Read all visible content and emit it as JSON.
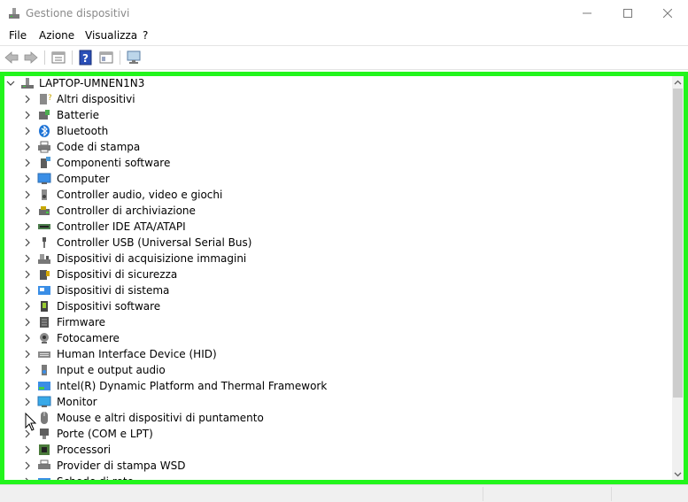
{
  "window": {
    "title": "Gestione dispositivi",
    "app_icon": "device-manager-icon",
    "controls": [
      "minimize-icon",
      "maximize-icon",
      "close-icon"
    ]
  },
  "menu": [
    "File",
    "Azione",
    "Visualizza",
    "?"
  ],
  "toolbar": {
    "buttons": [
      "back-arrow-icon",
      "forward-arrow-icon",
      "properties-icon",
      "help-icon",
      "show-hide-console-icon",
      "scan-hardware-changes-icon"
    ]
  },
  "tree": {
    "root": {
      "label": "LAPTOP-UMNEN1N3",
      "icon": "computer-root-icon",
      "expanded": true
    },
    "items": [
      {
        "label": "Altri dispositivi",
        "icon": "unknown-device-icon"
      },
      {
        "label": "Batterie",
        "icon": "battery-icon"
      },
      {
        "label": "Bluetooth",
        "icon": "bluetooth-icon"
      },
      {
        "label": "Code di stampa",
        "icon": "printer-icon"
      },
      {
        "label": "Componenti software",
        "icon": "software-component-icon"
      },
      {
        "label": "Computer",
        "icon": "computer-icon"
      },
      {
        "label": "Controller audio, video e giochi",
        "icon": "speaker-icon"
      },
      {
        "label": "Controller di archiviazione",
        "icon": "storage-controller-icon"
      },
      {
        "label": "Controller IDE ATA/ATAPI",
        "icon": "ide-controller-icon"
      },
      {
        "label": "Controller USB (Universal Serial Bus)",
        "icon": "usb-icon"
      },
      {
        "label": "Dispositivi di acquisizione immagini",
        "icon": "camera-scanner-icon"
      },
      {
        "label": "Dispositivi di sicurezza",
        "icon": "security-device-icon"
      },
      {
        "label": "Dispositivi di sistema",
        "icon": "system-device-icon"
      },
      {
        "label": "Dispositivi software",
        "icon": "software-device-icon"
      },
      {
        "label": "Firmware",
        "icon": "firmware-icon"
      },
      {
        "label": "Fotocamere",
        "icon": "webcam-icon"
      },
      {
        "label": "Human Interface Device (HID)",
        "icon": "hid-icon"
      },
      {
        "label": "Input e output audio",
        "icon": "audio-io-icon"
      },
      {
        "label": "Intel(R) Dynamic Platform and Thermal Framework",
        "icon": "intel-platform-icon"
      },
      {
        "label": "Monitor",
        "icon": "monitor-icon"
      },
      {
        "label": "Mouse e altri dispositivi di puntamento",
        "icon": "mouse-icon"
      },
      {
        "label": "Porte (COM e LPT)",
        "icon": "port-icon"
      },
      {
        "label": "Processori",
        "icon": "processor-icon"
      },
      {
        "label": "Provider di stampa WSD",
        "icon": "wsd-printer-icon"
      },
      {
        "label": "Schede di rete",
        "icon": "network-adapter-icon"
      }
    ]
  },
  "colors": {
    "highlight_border": "#22f51c",
    "title_text": "#8a8a8a",
    "scroll_thumb": "#cdcdcd"
  }
}
